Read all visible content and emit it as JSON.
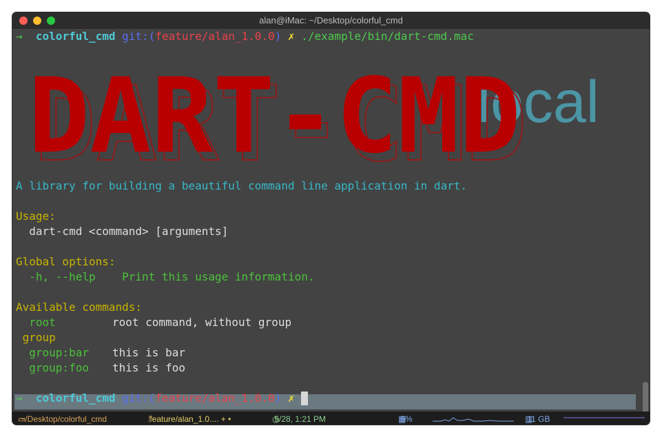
{
  "window": {
    "title": "alan@iMac: ~/Desktop/colorful_cmd"
  },
  "prompt1": {
    "arrow": "→",
    "dir": "colorful_cmd",
    "git_prefix": "git:(",
    "branch": "feature/alan_1.0.0",
    "git_suffix": ")",
    "dirty": "✗",
    "command": "./example/bin/dart-cmd.mac"
  },
  "banner": {
    "text": "DART-CMD",
    "watermark": "local",
    "color": "#b90000"
  },
  "output": {
    "description": "A library for building a beautiful command line application in dart.",
    "usage_header": "Usage:",
    "usage_line": "  dart-cmd <command> [arguments]",
    "global_header": "Global options:",
    "help_flag": "  -h, --help",
    "help_desc": "Print this usage information.",
    "commands_header": "Available commands:",
    "cmd_root": "  root",
    "cmd_root_desc": "root command, without group",
    "group_label": " group",
    "cmd_bar": "  group:bar",
    "cmd_bar_desc": "this is bar",
    "cmd_foo": "  group:foo",
    "cmd_foo_desc": "this is foo"
  },
  "prompt2": {
    "arrow": "→",
    "dir": "colorful_cmd",
    "git_prefix": "git:(",
    "branch": "feature/alan_1.0.0",
    "git_suffix": ")",
    "dirty": "✗"
  },
  "statusbar": {
    "path": "~/Desktop/colorful_cmd",
    "branch": "feature/alan_1.0.... + •",
    "time": "5/28, 1:21 PM",
    "cpu": "5%",
    "mem": "11 GB"
  },
  "colors": {
    "green": "#4ec94e",
    "cyan": "#4fc9d6",
    "red": "#e8434d",
    "yellow": "#eedd33",
    "banner": "#b90000"
  }
}
